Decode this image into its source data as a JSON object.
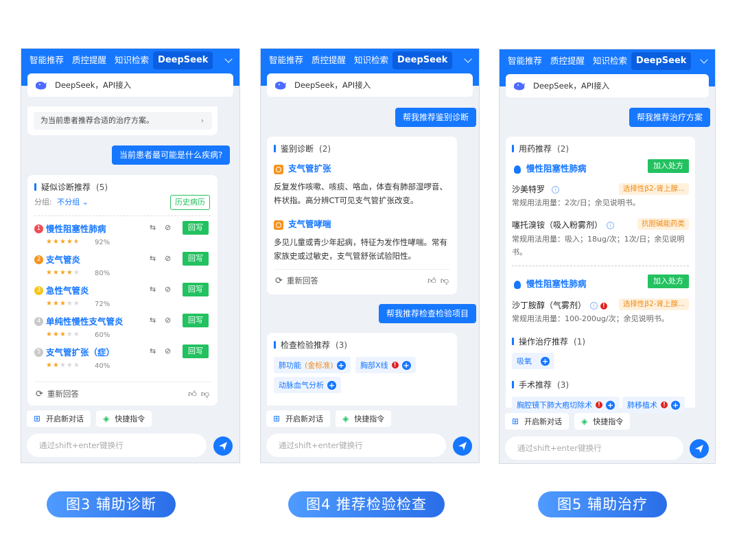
{
  "tabs": [
    "智能推荐",
    "质控提醒",
    "知识检索",
    "DeepSeek"
  ],
  "deepseek_label": "DeepSeek，API接入",
  "bottom": {
    "new_chat": "开启新对话",
    "quick_cmd": "快捷指令",
    "input_placeholder": "通过shift+enter键换行"
  },
  "panel1": {
    "prompt_suggestion": "为当前患者推荐合适的治疗方案。",
    "user_question": "当前患者最可能是什么疾病?",
    "section_title": "疑似诊断推荐",
    "section_count": "(5)",
    "group_label": "分组:",
    "group_value": "不分组",
    "history_button": "历史病历",
    "rewrite_label": "回写",
    "diagnoses": [
      {
        "num": "1",
        "name": "慢性阻塞性肺病",
        "pct": "92%",
        "stars": 4.5,
        "color": "#f04b55"
      },
      {
        "num": "2",
        "name": "支气管炎",
        "pct": "80%",
        "stars": 4,
        "color": "#f6931f"
      },
      {
        "num": "3",
        "name": "急性气管炎",
        "pct": "72%",
        "stars": 3,
        "color": "#f5c518"
      },
      {
        "num": "4",
        "name": "单纯性慢性支气管炎",
        "pct": "60%",
        "stars": 3,
        "color": "#c8c8c8"
      },
      {
        "num": "5",
        "name": "支气管扩张（症）",
        "pct": "40%",
        "stars": 2,
        "color": "#c8c8c8"
      }
    ],
    "regenerate": "重新回答"
  },
  "panel2": {
    "user_request1": "帮我推荐鉴别诊断",
    "section1_title": "鉴别诊断",
    "section1_count": "(2)",
    "diff": [
      {
        "name": "支气管扩张",
        "desc": "反复发作咳嗽、咳痰、咯血，体查有肺部湿啰音、杵状指。高分辨CT可见支气管扩张改变。"
      },
      {
        "name": "支气管哮喘",
        "desc": "多见儿童或青少年起病，特征为发作性哮喘。常有家族史或过敏史，支气管舒张试验阳性。"
      }
    ],
    "regenerate": "重新回答",
    "user_request2": "帮我推荐检查检验项目",
    "section2_title": "检查检验推荐",
    "section2_count": "(3)",
    "tests": [
      {
        "name": "肺功能",
        "sub": "(金标准)"
      },
      {
        "name": "胸部X线"
      },
      {
        "name": "动脉血气分析"
      }
    ]
  },
  "panel3": {
    "user_request": "帮我推荐治疗方案",
    "med_title": "用药推荐",
    "med_count": "(2)",
    "add_rx": "加入处方",
    "group1_disease": "慢性阻塞性肺病",
    "med1_name": "沙美特罗",
    "med1_tag": "选择性β2-肾上腺...",
    "med1_desc": "常规用法用量：2次/日；余见说明书。",
    "med2_name": "噻托溴铵（吸入粉雾剂）",
    "med2_tag": "抗胆碱能药类",
    "med2_desc": "常规用法用量：吸入；18ug/次；1次/日；余见说明书。",
    "group2_disease": "慢性阻塞性肺病",
    "med3_name": "沙丁胺醇（气雾剂）",
    "med3_tag": "选择性β2-肾上腺...",
    "med3_desc": "常规用法用量：100-200ug/次；余见说明书。",
    "op_title": "操作治疗推荐",
    "op_count": "(1)",
    "op_item": "吸氧",
    "surg_title": "手术推荐",
    "surg_count": "(3)",
    "surg1": "胸腔镜下肺大疱切除术",
    "surg2": "肺移植术"
  },
  "captions": [
    "图3 辅助诊断",
    "图4 推荐检验检查",
    "图5 辅助治疗"
  ]
}
